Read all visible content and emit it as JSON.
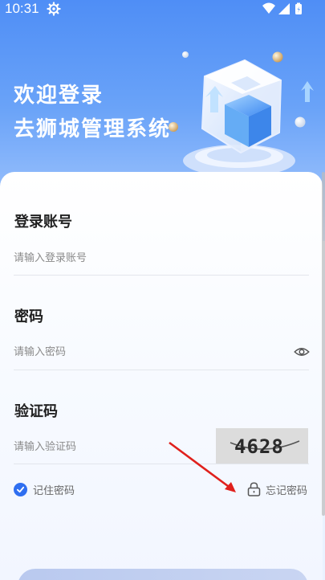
{
  "status_bar": {
    "time": "10:31",
    "icons": [
      "gear-icon",
      "wifi-icon",
      "signal-icon",
      "battery-icon"
    ]
  },
  "header": {
    "greeting_line1": "欢迎登录",
    "greeting_line2": "去狮城管理系统"
  },
  "form": {
    "account": {
      "label": "登录账号",
      "placeholder": "请输入登录账号",
      "value": ""
    },
    "password": {
      "label": "密码",
      "placeholder": "请输入密码",
      "value": ""
    },
    "captcha": {
      "label": "验证码",
      "placeholder": "请输入验证码",
      "value": "",
      "image_text": "4628"
    },
    "remember_label": "记住密码",
    "remember_checked": true,
    "forgot_label": "忘记密码"
  },
  "colors": {
    "primary": "#2f6ff0",
    "hero_top": "#4f8ef6",
    "annotation_arrow": "#e0201c"
  }
}
